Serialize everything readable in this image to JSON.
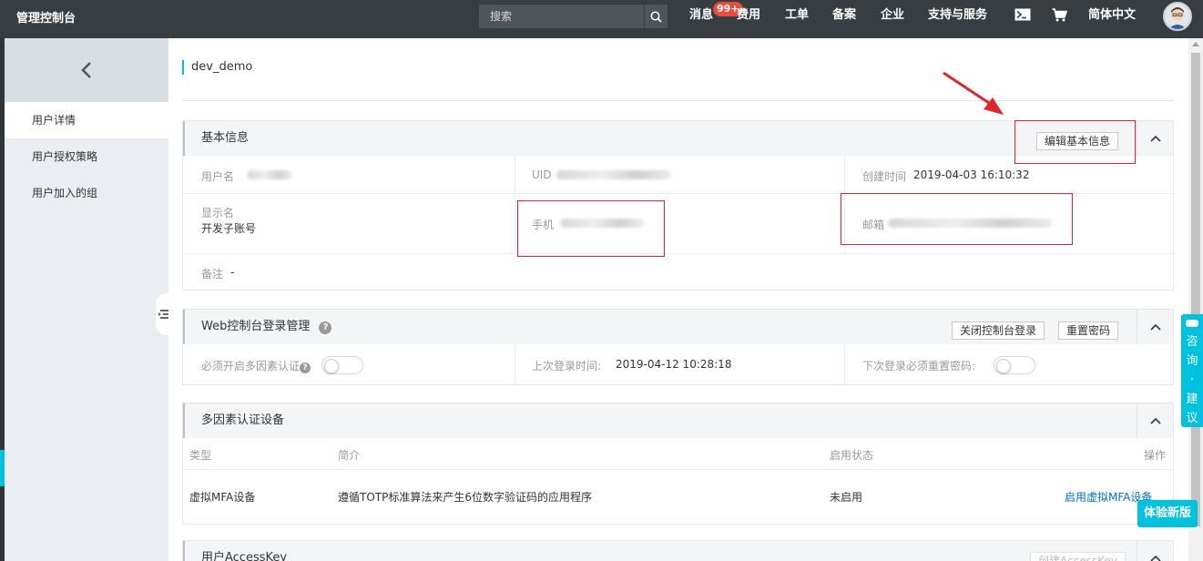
{
  "header": {
    "brand": "管理控制台",
    "search_placeholder": "搜索",
    "nav": [
      {
        "label": "消息"
      },
      {
        "label": "费用"
      },
      {
        "label": "工单"
      },
      {
        "label": "备案"
      },
      {
        "label": "企业"
      },
      {
        "label": "支持与服务"
      },
      {
        "label": "简体中文"
      }
    ],
    "message_badge": "99+"
  },
  "sidebar": {
    "items": [
      {
        "label": "用户详情"
      },
      {
        "label": "用户授权策略"
      },
      {
        "label": "用户加入的组"
      }
    ]
  },
  "page": {
    "title": "dev_demo"
  },
  "basic_info": {
    "title": "基本信息",
    "edit_button": "编辑基本信息",
    "username_label": "用户名",
    "uid_label": "UID",
    "created_label": "创建时间",
    "created_value": "2019-04-03 16:10:32",
    "display_name_label": "显示名",
    "display_name_value": "开发子账号",
    "phone_label": "手机",
    "email_label": "邮箱",
    "remark_label": "备注",
    "remark_value": "-"
  },
  "web_login": {
    "title": "Web控制台登录管理",
    "close_button": "关闭控制台登录",
    "reset_button": "重置密码",
    "mfa_required_label": "必须开启多因素认证",
    "last_login_label": "上次登录时间:",
    "last_login_value": "2019-04-12 10:28:18",
    "reset_next_label": "下次登录必须重置密码:"
  },
  "mfa": {
    "title": "多因素认证设备",
    "columns": [
      "类型",
      "简介",
      "启用状态",
      "操作"
    ],
    "rows": [
      {
        "type": "虚拟MFA设备",
        "desc": "遵循TOTP标准算法来产生6位数字验证码的应用程序",
        "status": "未启用",
        "action": "启用虚拟MFA设备"
      }
    ]
  },
  "access_key": {
    "title": "用户AccessKey",
    "create_button": "创建AccessKey"
  },
  "widgets": {
    "feedback": "咨询·建议",
    "new_version": "体验新版"
  },
  "colors": {
    "topbar": "#373d41",
    "accent": "#00c1de",
    "annotation_red": "#e0242c",
    "link": "#0070cc"
  }
}
